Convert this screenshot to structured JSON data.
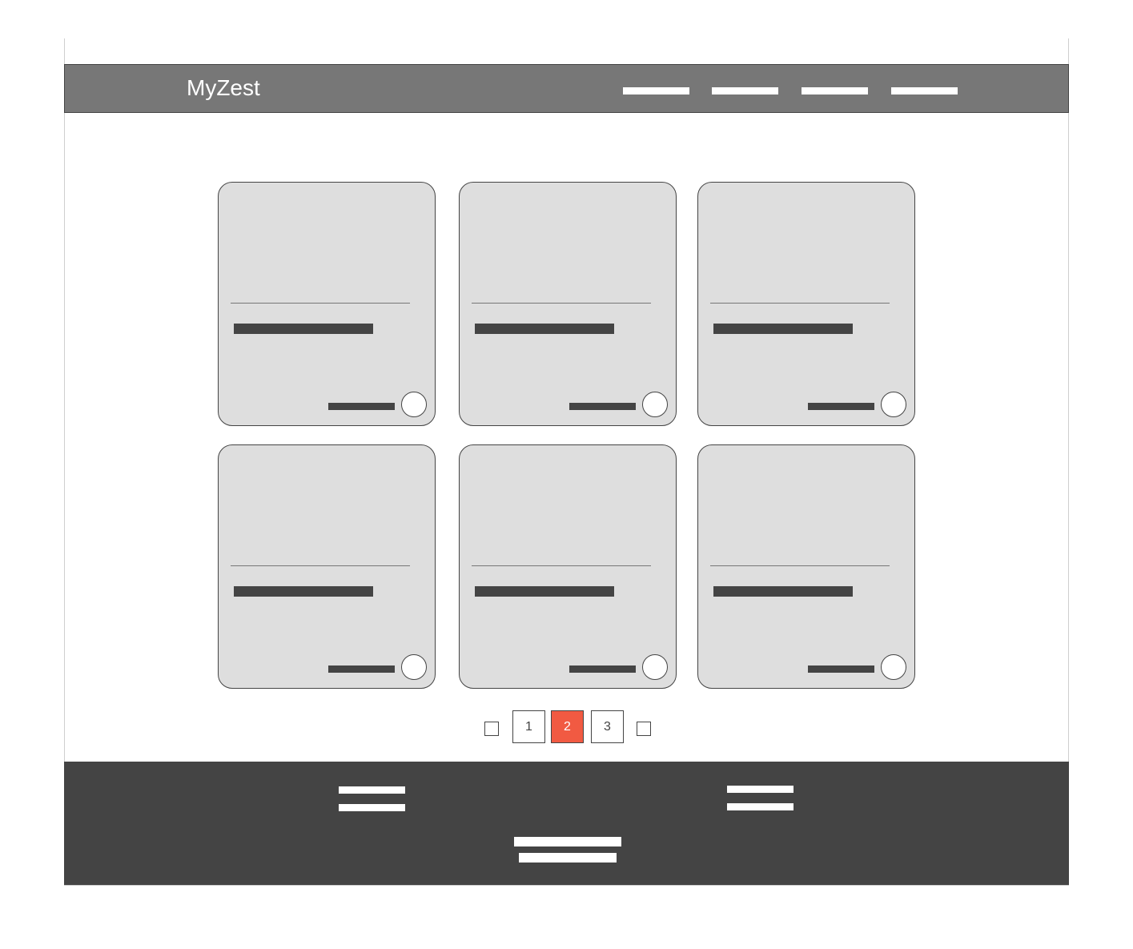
{
  "app": {
    "brand": "MyZest"
  },
  "nav": {
    "links": [
      "",
      "",
      "",
      ""
    ]
  },
  "cards": [
    {
      "title": "",
      "meta": ""
    },
    {
      "title": "",
      "meta": ""
    },
    {
      "title": "",
      "meta": ""
    },
    {
      "title": "",
      "meta": ""
    },
    {
      "title": "",
      "meta": ""
    },
    {
      "title": "",
      "meta": ""
    }
  ],
  "pagination": {
    "pages": [
      "1",
      "2",
      "3"
    ],
    "current": "2"
  },
  "colors": {
    "navbar": "#777777",
    "card": "#dedede",
    "active_page": "#f15a42",
    "footer": "#444444"
  },
  "icons": {
    "prev": "prev-page-icon",
    "next": "next-page-icon",
    "card_action": "circle-icon"
  }
}
